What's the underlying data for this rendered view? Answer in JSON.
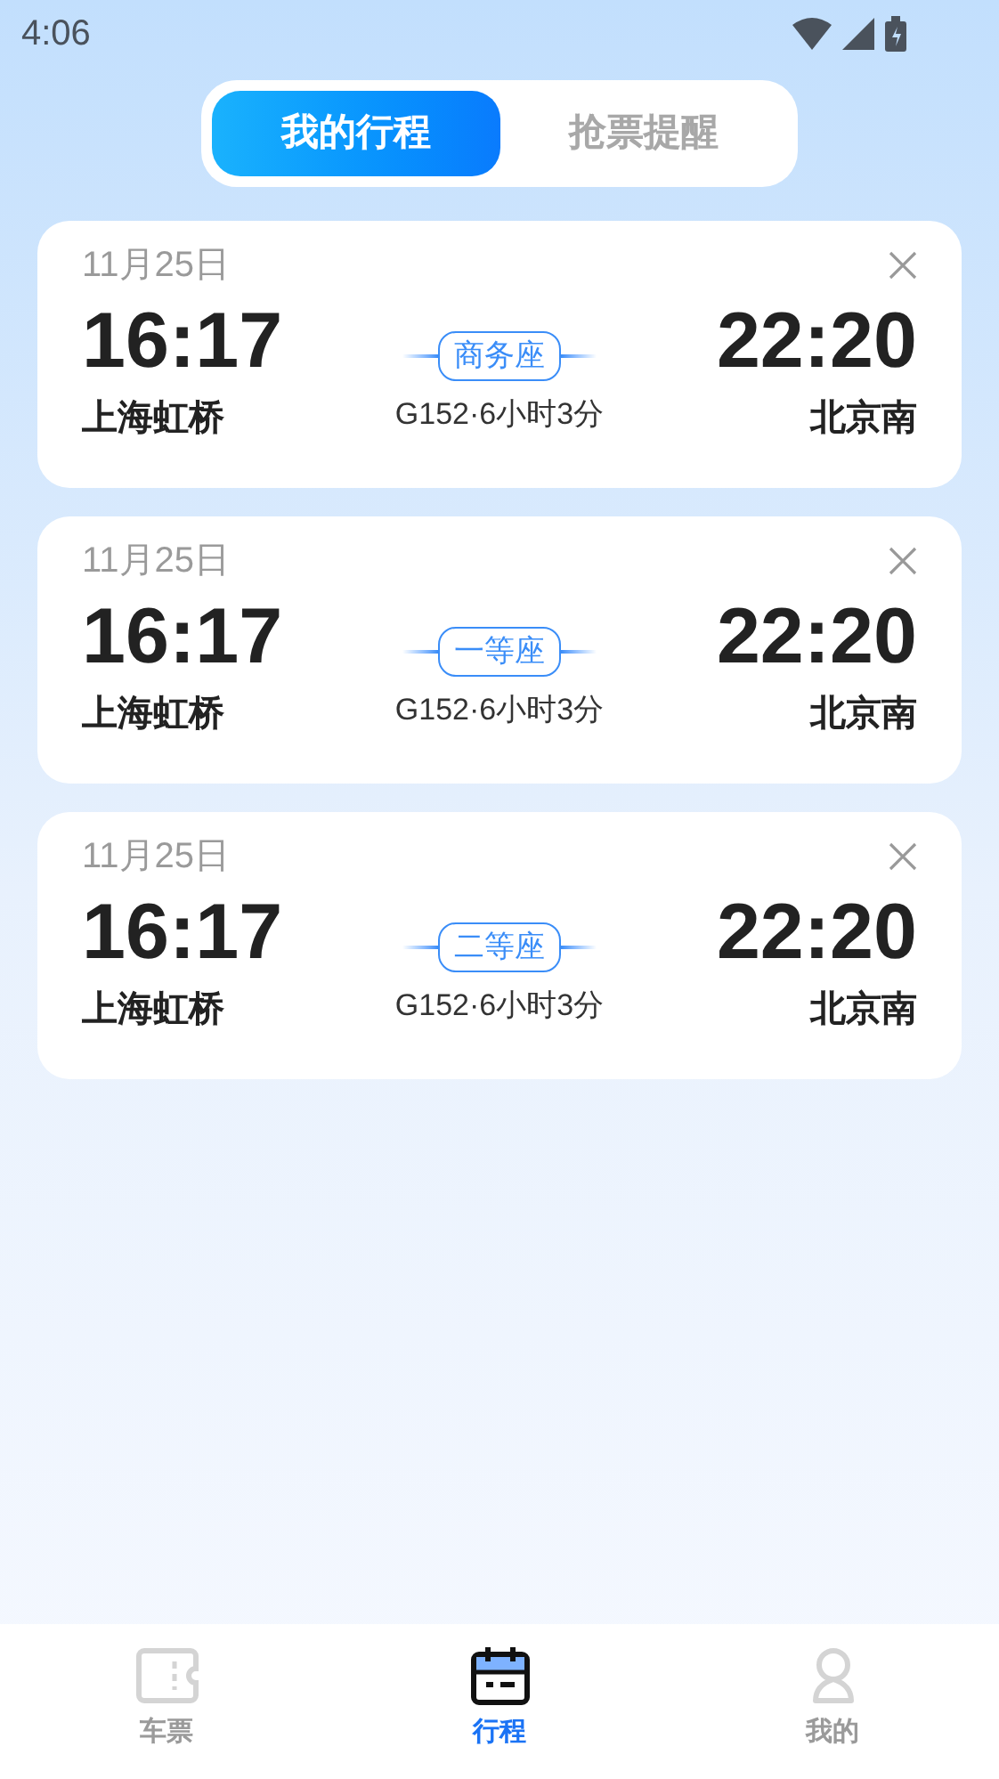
{
  "status_bar": {
    "time": "4:06"
  },
  "tabs": [
    {
      "label": "我的行程",
      "selected": true
    },
    {
      "label": "抢票提醒",
      "selected": false
    }
  ],
  "trips": [
    {
      "date": "11月25日",
      "depart_time": "16:17",
      "depart_station": "上海虹桥",
      "seat": "商务座",
      "train_info": "G152·6小时3分",
      "arrive_time": "22:20",
      "arrive_station": "北京南"
    },
    {
      "date": "11月25日",
      "depart_time": "16:17",
      "depart_station": "上海虹桥",
      "seat": "一等座",
      "train_info": "G152·6小时3分",
      "arrive_time": "22:20",
      "arrive_station": "北京南"
    },
    {
      "date": "11月25日",
      "depart_time": "16:17",
      "depart_station": "上海虹桥",
      "seat": "二等座",
      "train_info": "G152·6小时3分",
      "arrive_time": "22:20",
      "arrive_station": "北京南"
    }
  ],
  "bottom_nav": [
    {
      "kind": "ticket",
      "label": "车票",
      "selected": false
    },
    {
      "kind": "calendar",
      "label": "行程",
      "selected": true
    },
    {
      "kind": "person",
      "label": "我的",
      "selected": false
    }
  ]
}
